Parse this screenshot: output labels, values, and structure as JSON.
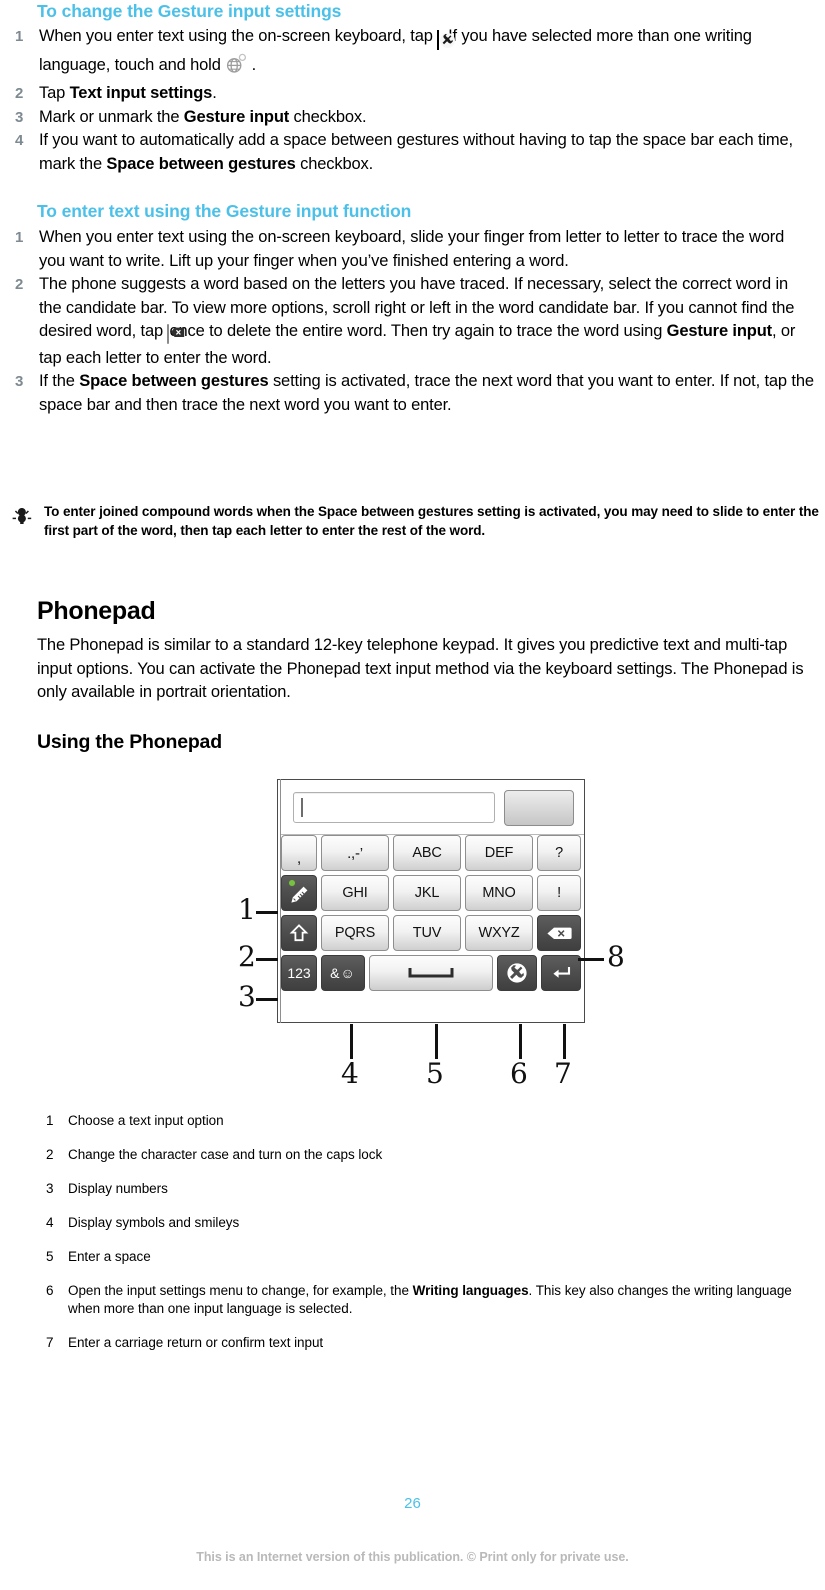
{
  "sections": {
    "gesture_settings": {
      "heading": "To change the Gesture input settings",
      "steps": [
        {
          "num": "1",
          "part1": "When you enter text using the on-screen keyboard, tap",
          "icon1": "wrench-icon",
          "part2": ". If you have selected more than one writing language, touch and hold",
          "icon2": "globe-icon",
          "part3": "."
        },
        {
          "num": "2",
          "pre": "Tap ",
          "bold": "Text input settings",
          "post": "."
        },
        {
          "num": "3",
          "pre": "Mark or unmark the ",
          "bold": "Gesture input",
          "post": " checkbox."
        },
        {
          "num": "4",
          "pre": "If you want to automatically add a space between gestures without having to tap the space bar each time, mark the ",
          "bold": "Space between gestures",
          "post": " checkbox."
        }
      ]
    },
    "gesture_function": {
      "heading": "To enter text using the Gesture input function",
      "steps": [
        {
          "num": "1",
          "text": "When you enter text using the on-screen keyboard, slide your finger from letter to letter to trace the word you want to write. Lift up your finger when you’ve finished entering a word."
        },
        {
          "num": "2",
          "part1": "The phone suggests a word based on the letters you have traced. If necessary, select the correct word in the candidate bar. To view more options, scroll right or left in the word candidate bar. If you cannot find the desired word, tap",
          "icon1": "delete-key-icon",
          "part2": "once to delete the entire word. Then try again to trace the word using",
          "bold": "Gesture input",
          "part3": ", or tap each letter to enter the word."
        },
        {
          "num": "3",
          "pre": "If the ",
          "bold": "Space between gestures",
          "post": " setting is activated, trace the next word that you want to enter. If not, tap the space bar and then trace the next word you want to enter."
        }
      ]
    },
    "tip": {
      "icon": "lightbulb-tip-icon",
      "pre": "To enter joined compound words when the ",
      "bold": "Space between gestures",
      "post": " setting is activated, you may need to slide to enter the first part of the word, then tap each letter to enter the rest of the word."
    },
    "phonepad": {
      "heading": "Phonepad",
      "paragraph": "The Phonepad is similar to a standard 12-key telephone keypad. It gives you predictive text and multi-tap input options. You can activate the Phonepad text input method via the keyboard settings. The Phonepad is only available in portrait orientation."
    },
    "using_phonepad": {
      "heading": "Using the Phonepad"
    }
  },
  "keypad": {
    "candidate_input_value": "",
    "candidate_button_label": "",
    "rows": [
      [
        {
          "label": ",",
          "style": "light",
          "name": "key-comma"
        },
        {
          "label": ".,-’",
          "style": "light",
          "name": "key-punctuation"
        },
        {
          "label": "ABC",
          "style": "light",
          "name": "key-abc"
        },
        {
          "label": "DEF",
          "style": "light",
          "name": "key-def"
        },
        {
          "label": "?",
          "style": "light",
          "name": "key-question"
        }
      ],
      [
        {
          "label": "",
          "style": "dark",
          "name": "key-text-input-option",
          "icon": "pencil-gesture-icon",
          "dot": true
        },
        {
          "label": "GHI",
          "style": "light",
          "name": "key-ghi"
        },
        {
          "label": "JKL",
          "style": "light",
          "name": "key-jkl"
        },
        {
          "label": "MNO",
          "style": "light",
          "name": "key-mno"
        },
        {
          "label": "!",
          "style": "light",
          "name": "key-exclamation"
        }
      ],
      [
        {
          "label": "",
          "style": "dark",
          "name": "key-shift-caps",
          "icon": "shift-arrow-icon"
        },
        {
          "label": "PQRS",
          "style": "light",
          "name": "key-pqrs"
        },
        {
          "label": "TUV",
          "style": "light",
          "name": "key-tuv"
        },
        {
          "label": "WXYZ",
          "style": "light",
          "name": "key-wxyz"
        },
        {
          "label": "",
          "style": "dark",
          "name": "key-backspace",
          "icon": "backspace-icon"
        }
      ],
      [
        {
          "label": "123",
          "style": "dark",
          "name": "key-numbers"
        },
        {
          "label": "&☺",
          "style": "dark",
          "name": "key-symbols-smileys",
          "icon": "ampersand-smiley-icon"
        },
        {
          "label": "",
          "style": "space",
          "name": "key-space",
          "icon": "space-bar-icon"
        },
        {
          "label": "",
          "style": "dark",
          "name": "key-input-settings",
          "icon": "wrench-icon"
        },
        {
          "label": "",
          "style": "dark",
          "name": "key-enter",
          "icon": "enter-return-icon"
        }
      ]
    ],
    "callouts": [
      "1",
      "2",
      "3",
      "4",
      "5",
      "6",
      "7",
      "8"
    ]
  },
  "legend": [
    {
      "num": "1",
      "text": "Choose a text input option"
    },
    {
      "num": "2",
      "text": "Change the character case and turn on the caps lock"
    },
    {
      "num": "3",
      "text": "Display numbers"
    },
    {
      "num": "4",
      "text": "Display symbols and smileys"
    },
    {
      "num": "5",
      "text": "Enter a space"
    },
    {
      "num": "6",
      "pre": "Open the input settings menu to change, for example, the ",
      "bold": "Writing languages",
      "post": ". This key also changes the writing language when more than one input language is selected."
    },
    {
      "num": "7",
      "text": "Enter a carriage return or confirm text input"
    }
  ],
  "footer": {
    "page_number": "26",
    "note": "This is an Internet version of this publication. © Print only for private use."
  },
  "colors": {
    "heading_blue": "#4BC0E8",
    "step_number_gray": "#7D8A92",
    "footer_gray": "#B9B9B9",
    "key_dark": "#4D4D4D",
    "green_dot": "#79C143"
  }
}
